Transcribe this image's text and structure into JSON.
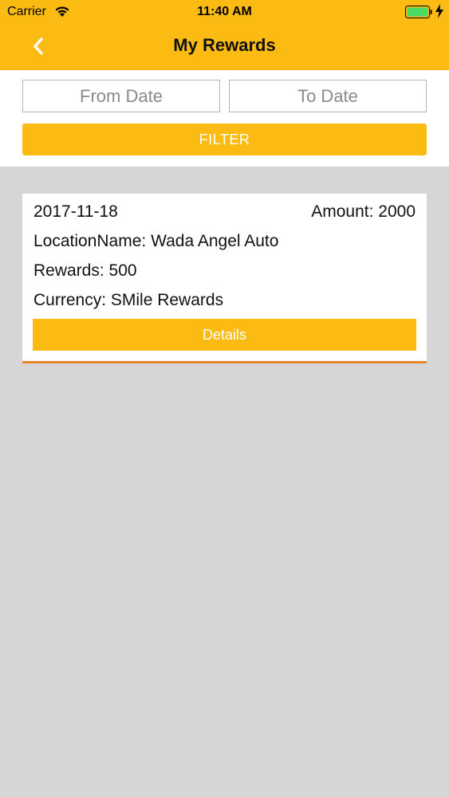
{
  "status_bar": {
    "carrier": "Carrier",
    "time": "11:40 AM",
    "icons": [
      "wifi-icon",
      "battery-icon",
      "charging-bolt-icon"
    ],
    "battery_color": "#4cd964"
  },
  "nav": {
    "back_icon": "chevron-left-icon",
    "title": "My Rewards"
  },
  "filter": {
    "from_placeholder": "From Date",
    "to_placeholder": "To Date",
    "button_label": "FILTER"
  },
  "colors": {
    "accent": "#fbbb13",
    "card_underline": "#e8862d",
    "background": "#d6d6d8"
  },
  "rewards": [
    {
      "date": "2017-11-18",
      "amount": "Amount: 2000",
      "location": "LocationName: Wada Angel Auto",
      "rewards": "Rewards: 500",
      "currency": "Currency: SMile Rewards",
      "details_label": "Details"
    }
  ]
}
